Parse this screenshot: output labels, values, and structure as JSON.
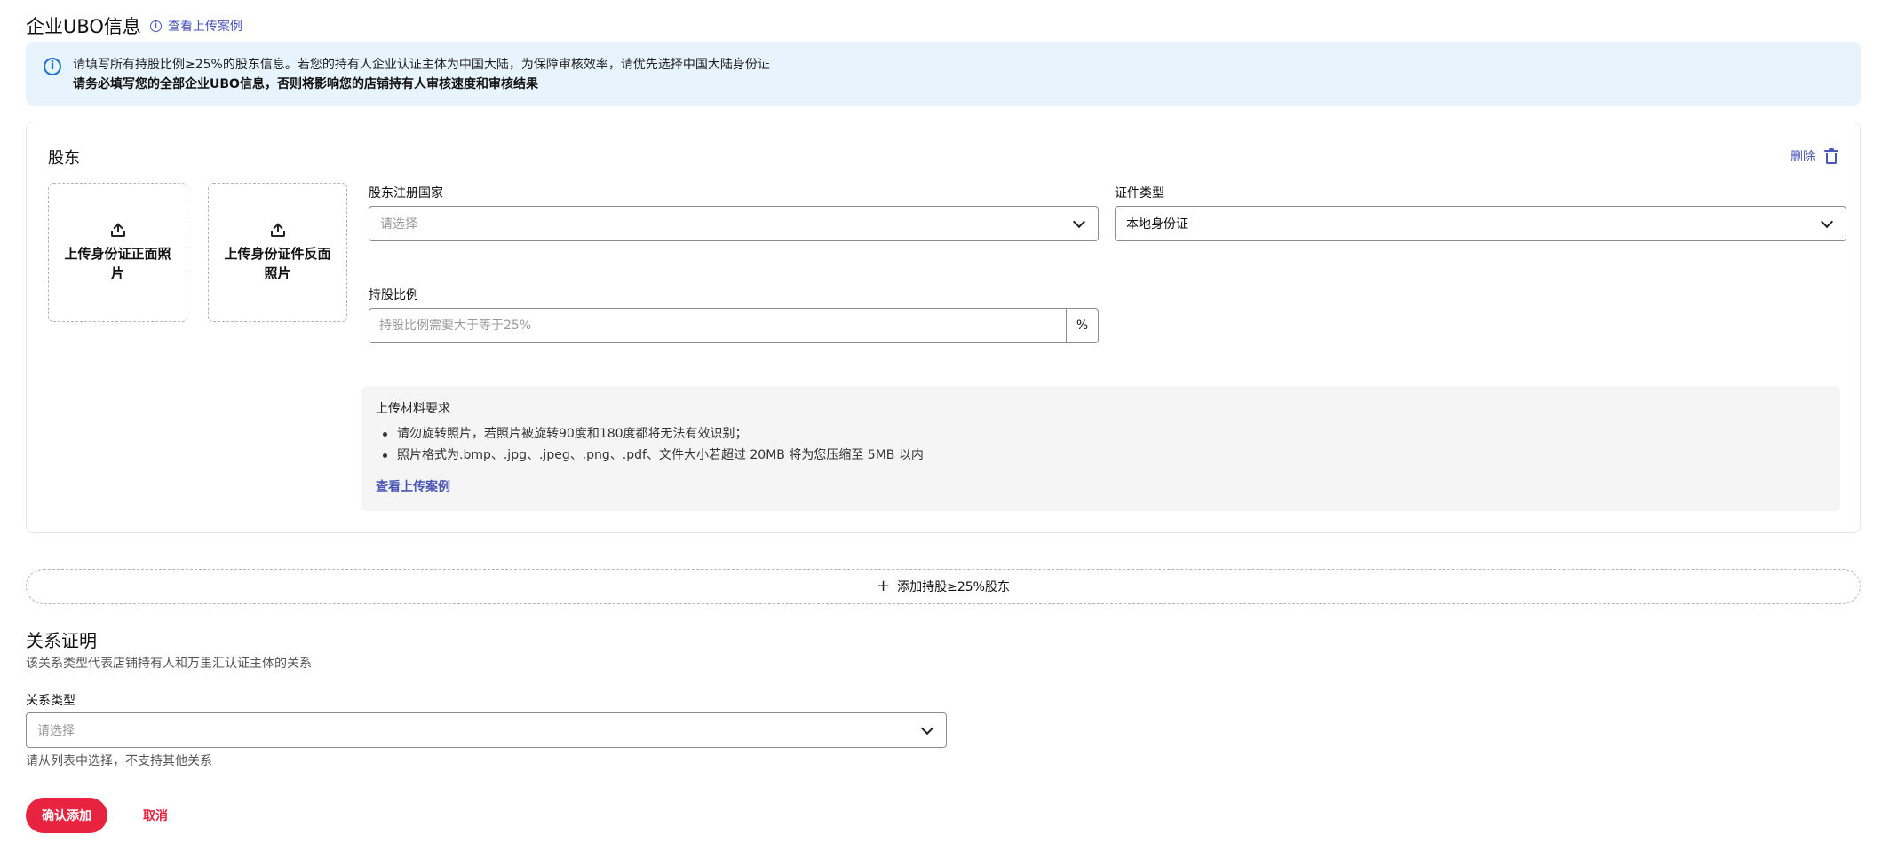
{
  "ubo_section": {
    "title": "企业UBO信息",
    "example_link": "查看上传案例"
  },
  "banner": {
    "line1": "请填写所有持股比例≥25%的股东信息。若您的持有人企业认证主体为中国大陆，为保障审核效率，请优先选择中国大陆身份证",
    "line2": "请务必填写您的全部企业UBO信息，否则将影响您的店铺持有人审核速度和审核结果"
  },
  "shareholder_card": {
    "title": "股东",
    "delete_label": "删除",
    "upload_front": "上传身份证正面照片",
    "upload_back": "上传身份证件反面照片",
    "country_label": "股东注册国家",
    "country_placeholder": "请选择",
    "id_type_label": "证件类型",
    "id_type_value": "本地身份证",
    "share_label": "持股比例",
    "share_placeholder": "持股比例需要大于等于25%",
    "share_suffix": "%",
    "requirements": {
      "title": "上传材料要求",
      "items": [
        "请勿旋转照片，若照片被旋转90度和180度都将无法有效识别；",
        "照片格式为.bmp、.jpg、.jpeg、.png、.pdf、文件大小若超过 20MB 将为您压缩至 5MB 以内"
      ],
      "link": "查看上传案例"
    }
  },
  "add_shareholder": {
    "label": "添加持股≥25%股东"
  },
  "relation": {
    "title": "关系证明",
    "description": "该关系类型代表店铺持有人和万里汇认证主体的关系",
    "type_label": "关系类型",
    "type_placeholder": "请选择",
    "help": "请从列表中选择，不支持其他关系"
  },
  "actions": {
    "confirm": "确认添加",
    "cancel": "取消"
  },
  "colors": {
    "accent_link": "#4a55b8",
    "primary_button": "#e8233f",
    "banner_bg": "#e8f4fd",
    "info_icon": "#1a73c8"
  },
  "icons": [
    "info-icon",
    "trash-icon",
    "upload-icon",
    "chevron-down-icon",
    "plus-icon"
  ]
}
